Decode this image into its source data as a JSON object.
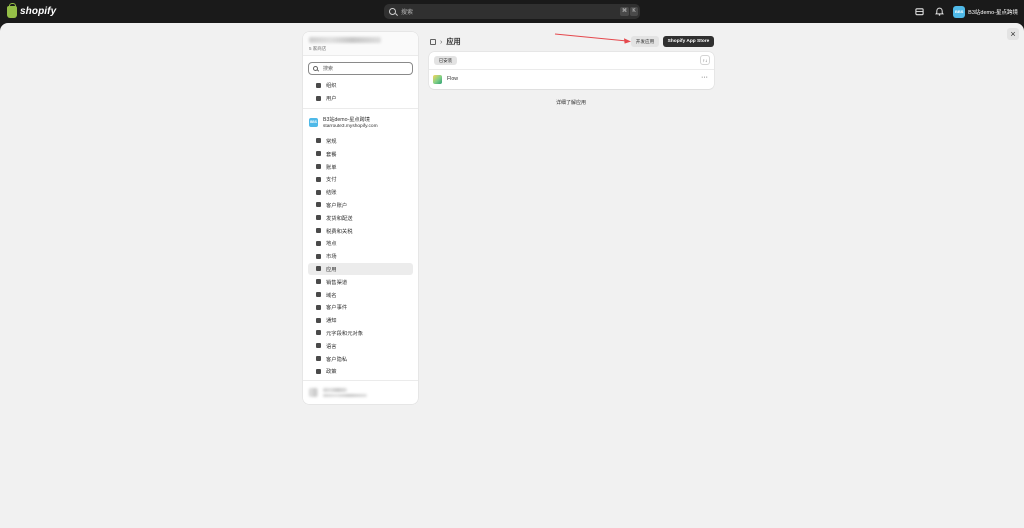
{
  "topbar": {
    "logo_text": "shopify",
    "search_placeholder": "搜索",
    "kbd_cmd": "⌘",
    "kbd_k": "K",
    "store_initials": "BBS",
    "store_name": "B3站demo-星点跨境"
  },
  "sidebar": {
    "header_sub": "5 家商店",
    "search_placeholder": "搜索",
    "org_items": [
      {
        "label": "组织",
        "icon": "building-icon"
      },
      {
        "label": "用户",
        "icon": "users-icon"
      }
    ],
    "store": {
      "initials": "BBS",
      "name": "B3站demo-星点跨境",
      "domain": "starroute3.myshopify.com"
    },
    "items": [
      {
        "label": "常规",
        "icon": "store-icon"
      },
      {
        "label": "套餐",
        "icon": "plan-icon"
      },
      {
        "label": "账单",
        "icon": "billing-icon"
      },
      {
        "label": "支付",
        "icon": "payment-icon"
      },
      {
        "label": "结账",
        "icon": "cart-icon"
      },
      {
        "label": "客户账户",
        "icon": "person-icon"
      },
      {
        "label": "发货和配送",
        "icon": "truck-icon"
      },
      {
        "label": "税费和关税",
        "icon": "tax-icon"
      },
      {
        "label": "地点",
        "icon": "location-icon"
      },
      {
        "label": "市场",
        "icon": "globe-icon"
      },
      {
        "label": "应用",
        "icon": "apps-icon",
        "active": true
      },
      {
        "label": "销售渠道",
        "icon": "channels-icon"
      },
      {
        "label": "域名",
        "icon": "domain-icon"
      },
      {
        "label": "客户事件",
        "icon": "events-icon"
      },
      {
        "label": "通知",
        "icon": "bell-icon"
      },
      {
        "label": "元字段和元对象",
        "icon": "metafields-icon"
      },
      {
        "label": "语言",
        "icon": "language-icon"
      },
      {
        "label": "客户隐私",
        "icon": "lock-icon"
      },
      {
        "label": "政策",
        "icon": "policy-icon"
      }
    ]
  },
  "main": {
    "breadcrumb_title": "应用",
    "develop_button": "开发应用",
    "appstore_button": "Shopify App Store",
    "filter_label": "已安装",
    "sort_icon": "↑↓",
    "apps": [
      {
        "name": "Flow",
        "icon": "flow-icon"
      }
    ],
    "more_icon": "···",
    "learn_more": "详细了解应用",
    "close_icon": "×"
  },
  "colors": {
    "topbar": "#1a1a1a",
    "panel": "#f1f1f1",
    "accent_dark": "#303030",
    "arrow": "#e5484d",
    "store_avatar": "#4fb9e8"
  }
}
